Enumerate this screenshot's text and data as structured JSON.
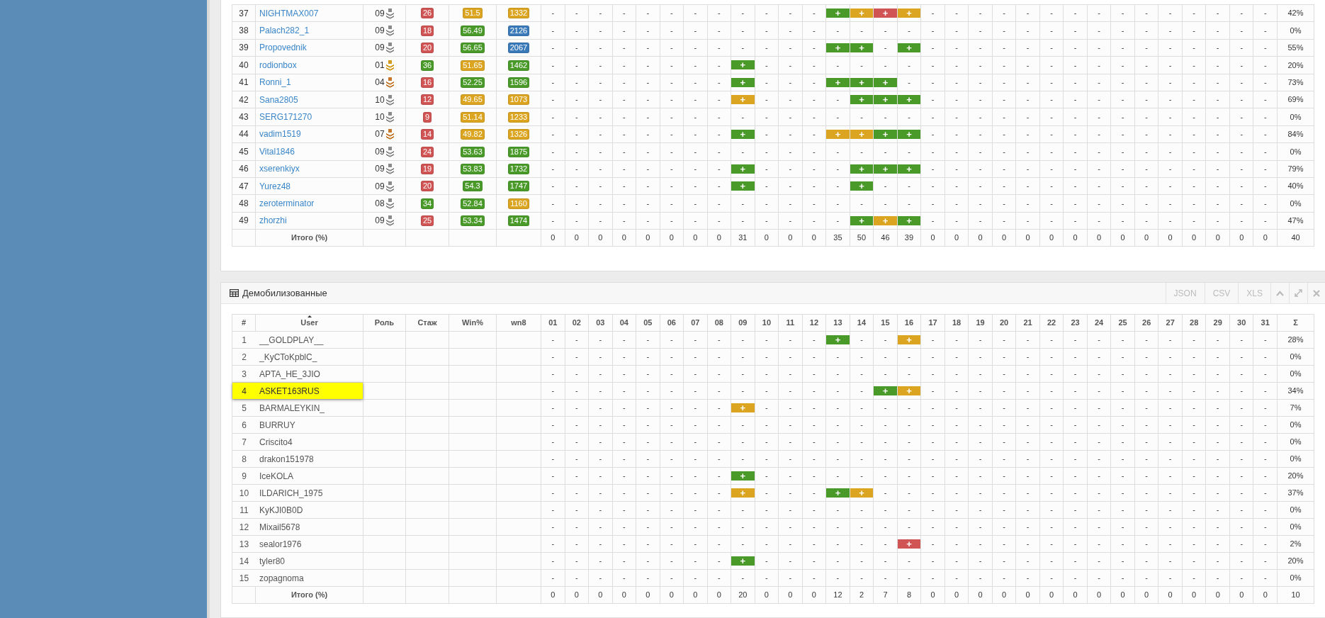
{
  "top_table": {
    "rows": [
      {
        "n": "37",
        "user": "NIGHTMAX007",
        "role": "09",
        "color": "#8a8a8a",
        "stazh": {
          "text": "26",
          "color": "#d05454"
        },
        "win": {
          "text": "51.5",
          "color": "#dba521"
        },
        "wn8": {
          "text": "1332",
          "color": "#dba521"
        },
        "days": [
          "-",
          "-",
          "-",
          "-",
          "-",
          "-",
          "-",
          "-",
          "-",
          "-",
          "-",
          "-",
          {
            "text": "+",
            "color": "#4a9a2a"
          },
          {
            "text": "+",
            "color": "#dba521"
          },
          {
            "text": "+",
            "color": "#d05454"
          },
          {
            "text": "+",
            "color": "#dba521"
          },
          "-",
          "-",
          "-",
          "-",
          "-",
          "-",
          "-",
          "-",
          "-",
          "-",
          "-",
          "-",
          "-",
          "-",
          "-"
        ],
        "sum": "42%"
      },
      {
        "n": "38",
        "user": "Palach282_1",
        "role": "09",
        "color": "#8a8a8a",
        "stazh": {
          "text": "18",
          "color": "#d05454"
        },
        "win": {
          "text": "56.49",
          "color": "#4a9a2a"
        },
        "wn8": {
          "text": "2126",
          "color": "#3a7ab8"
        },
        "days": [
          "-",
          "-",
          "-",
          "-",
          "-",
          "-",
          "-",
          "-",
          "-",
          "-",
          "-",
          "-",
          "-",
          "-",
          "-",
          "-",
          "-",
          "-",
          "-",
          "-",
          "-",
          "-",
          "-",
          "-",
          "-",
          "-",
          "-",
          "-",
          "-",
          "-",
          "-"
        ],
        "sum": "0%"
      },
      {
        "n": "39",
        "user": "Propovednik",
        "role": "09",
        "color": "#8a8a8a",
        "stazh": {
          "text": "20",
          "color": "#d05454"
        },
        "win": {
          "text": "56.65",
          "color": "#4a9a2a"
        },
        "wn8": {
          "text": "2067",
          "color": "#3a7ab8"
        },
        "days": [
          "-",
          "-",
          "-",
          "-",
          "-",
          "-",
          "-",
          "-",
          "-",
          "-",
          "-",
          "-",
          {
            "text": "+",
            "color": "#4a9a2a"
          },
          {
            "text": "+",
            "color": "#4a9a2a"
          },
          "-",
          {
            "text": "+",
            "color": "#4a9a2a"
          },
          "-",
          "-",
          "-",
          "-",
          "-",
          "-",
          "-",
          "-",
          "-",
          "-",
          "-",
          "-",
          "-",
          "-",
          "-"
        ],
        "sum": "55%"
      },
      {
        "n": "40",
        "user": "rodionbox",
        "role": "01",
        "color": "#d39a1c",
        "stazh": {
          "text": "36",
          "color": "#4a9a2a"
        },
        "win": {
          "text": "51.65",
          "color": "#dba521"
        },
        "wn8": {
          "text": "1462",
          "color": "#4a9a2a"
        },
        "days": [
          "-",
          "-",
          "-",
          "-",
          "-",
          "-",
          "-",
          "-",
          {
            "text": "+",
            "color": "#4a9a2a"
          },
          "-",
          "-",
          "-",
          "-",
          "-",
          "-",
          "-",
          "-",
          "-",
          "-",
          "-",
          "-",
          "-",
          "-",
          "-",
          "-",
          "-",
          "-",
          "-",
          "-",
          "-",
          "-"
        ],
        "sum": "20%"
      },
      {
        "n": "41",
        "user": "Ronni_1",
        "role": "04",
        "color": "#c8782c",
        "stazh": {
          "text": "16",
          "color": "#d05454"
        },
        "win": {
          "text": "52.25",
          "color": "#4a9a2a"
        },
        "wn8": {
          "text": "1596",
          "color": "#4a9a2a"
        },
        "days": [
          "-",
          "-",
          "-",
          "-",
          "-",
          "-",
          "-",
          "-",
          {
            "text": "+",
            "color": "#4a9a2a"
          },
          "-",
          "-",
          "-",
          {
            "text": "+",
            "color": "#4a9a2a"
          },
          {
            "text": "+",
            "color": "#4a9a2a"
          },
          {
            "text": "+",
            "color": "#4a9a2a"
          },
          "-",
          "-",
          "-",
          "-",
          "-",
          "-",
          "-",
          "-",
          "-",
          "-",
          "-",
          "-",
          "-",
          "-",
          "-",
          "-"
        ],
        "sum": "73%"
      },
      {
        "n": "42",
        "user": "Sana2805",
        "role": "10",
        "color": "#8a8a8a",
        "stazh": {
          "text": "12",
          "color": "#d05454"
        },
        "win": {
          "text": "49.65",
          "color": "#dba521"
        },
        "wn8": {
          "text": "1073",
          "color": "#dba521"
        },
        "days": [
          "-",
          "-",
          "-",
          "-",
          "-",
          "-",
          "-",
          "-",
          {
            "text": "+",
            "color": "#dba521"
          },
          "-",
          "-",
          "-",
          "-",
          {
            "text": "+",
            "color": "#4a9a2a"
          },
          {
            "text": "+",
            "color": "#4a9a2a"
          },
          {
            "text": "+",
            "color": "#4a9a2a"
          },
          "-",
          "-",
          "-",
          "-",
          "-",
          "-",
          "-",
          "-",
          "-",
          "-",
          "-",
          "-",
          "-",
          "-",
          "-"
        ],
        "sum": "69%"
      },
      {
        "n": "43",
        "user": "SERG171270",
        "role": "10",
        "color": "#8a8a8a",
        "stazh": {
          "text": "9",
          "color": "#d05454"
        },
        "win": {
          "text": "51.14",
          "color": "#dba521"
        },
        "wn8": {
          "text": "1233",
          "color": "#dba521"
        },
        "days": [
          "-",
          "-",
          "-",
          "-",
          "-",
          "-",
          "-",
          "-",
          "-",
          "-",
          "-",
          "-",
          "-",
          "-",
          "-",
          "-",
          "-",
          "-",
          "-",
          "-",
          "-",
          "-",
          "-",
          "-",
          "-",
          "-",
          "-",
          "-",
          "-",
          "-",
          "-"
        ],
        "sum": "0%"
      },
      {
        "n": "44",
        "user": "vadim1519",
        "role": "07",
        "color": "#c8782c",
        "stazh": {
          "text": "14",
          "color": "#d05454"
        },
        "win": {
          "text": "49.82",
          "color": "#dba521"
        },
        "wn8": {
          "text": "1326",
          "color": "#dba521"
        },
        "days": [
          "-",
          "-",
          "-",
          "-",
          "-",
          "-",
          "-",
          "-",
          {
            "text": "+",
            "color": "#4a9a2a"
          },
          "-",
          "-",
          "-",
          {
            "text": "+",
            "color": "#dba521"
          },
          {
            "text": "+",
            "color": "#dba521"
          },
          {
            "text": "+",
            "color": "#4a9a2a"
          },
          {
            "text": "+",
            "color": "#4a9a2a"
          },
          "-",
          "-",
          "-",
          "-",
          "-",
          "-",
          "-",
          "-",
          "-",
          "-",
          "-",
          "-",
          "-",
          "-",
          "-"
        ],
        "sum": "84%"
      },
      {
        "n": "45",
        "user": "Vital1846",
        "role": "09",
        "color": "#8a8a8a",
        "stazh": {
          "text": "24",
          "color": "#d05454"
        },
        "win": {
          "text": "53.63",
          "color": "#4a9a2a"
        },
        "wn8": {
          "text": "1875",
          "color": "#4a9a2a"
        },
        "days": [
          "-",
          "-",
          "-",
          "-",
          "-",
          "-",
          "-",
          "-",
          "-",
          "-",
          "-",
          "-",
          "-",
          "-",
          "-",
          "-",
          "-",
          "-",
          "-",
          "-",
          "-",
          "-",
          "-",
          "-",
          "-",
          "-",
          "-",
          "-",
          "-",
          "-",
          "-"
        ],
        "sum": "0%"
      },
      {
        "n": "46",
        "user": "xserenkiyx",
        "role": "09",
        "color": "#8a8a8a",
        "stazh": {
          "text": "19",
          "color": "#d05454"
        },
        "win": {
          "text": "53.83",
          "color": "#4a9a2a"
        },
        "wn8": {
          "text": "1732",
          "color": "#4a9a2a"
        },
        "days": [
          "-",
          "-",
          "-",
          "-",
          "-",
          "-",
          "-",
          "-",
          {
            "text": "+",
            "color": "#4a9a2a"
          },
          "-",
          "-",
          "-",
          "-",
          {
            "text": "+",
            "color": "#4a9a2a"
          },
          {
            "text": "+",
            "color": "#4a9a2a"
          },
          {
            "text": "+",
            "color": "#4a9a2a"
          },
          "-",
          "-",
          "-",
          "-",
          "-",
          "-",
          "-",
          "-",
          "-",
          "-",
          "-",
          "-",
          "-",
          "-",
          "-"
        ],
        "sum": "79%"
      },
      {
        "n": "47",
        "user": "Yurez48",
        "role": "09",
        "color": "#8a8a8a",
        "stazh": {
          "text": "20",
          "color": "#d05454"
        },
        "win": {
          "text": "54.3",
          "color": "#4a9a2a"
        },
        "wn8": {
          "text": "1747",
          "color": "#4a9a2a"
        },
        "days": [
          "-",
          "-",
          "-",
          "-",
          "-",
          "-",
          "-",
          "-",
          {
            "text": "+",
            "color": "#4a9a2a"
          },
          "-",
          "-",
          "-",
          "-",
          {
            "text": "+",
            "color": "#4a9a2a"
          },
          "-",
          "-",
          "-",
          "-",
          "-",
          "-",
          "-",
          "-",
          "-",
          "-",
          "-",
          "-",
          "-",
          "-",
          "-",
          "-",
          "-"
        ],
        "sum": "40%"
      },
      {
        "n": "48",
        "user": "zeroterminator",
        "role": "08",
        "color": "#8a8a8a",
        "stazh": {
          "text": "34",
          "color": "#4a9a2a"
        },
        "win": {
          "text": "52.84",
          "color": "#4a9a2a"
        },
        "wn8": {
          "text": "1160",
          "color": "#dba521"
        },
        "days": [
          "-",
          "-",
          "-",
          "-",
          "-",
          "-",
          "-",
          "-",
          "-",
          "-",
          "-",
          "-",
          "-",
          "-",
          "-",
          "-",
          "-",
          "-",
          "-",
          "-",
          "-",
          "-",
          "-",
          "-",
          "-",
          "-",
          "-",
          "-",
          "-",
          "-",
          "-"
        ],
        "sum": "0%"
      },
      {
        "n": "49",
        "user": "zhorzhi",
        "role": "09",
        "color": "#8a8a8a",
        "stazh": {
          "text": "25",
          "color": "#d05454"
        },
        "win": {
          "text": "53.34",
          "color": "#4a9a2a"
        },
        "wn8": {
          "text": "1474",
          "color": "#4a9a2a"
        },
        "days": [
          "-",
          "-",
          "-",
          "-",
          "-",
          "-",
          "-",
          "-",
          "-",
          "-",
          "-",
          "-",
          "-",
          {
            "text": "+",
            "color": "#4a9a2a"
          },
          {
            "text": "+",
            "color": "#dba521"
          },
          {
            "text": "+",
            "color": "#4a9a2a"
          },
          "-",
          "-",
          "-",
          "-",
          "-",
          "-",
          "-",
          "-",
          "-",
          "-",
          "-",
          "-",
          "-",
          "-",
          "-"
        ],
        "sum": "47%"
      }
    ],
    "footer": {
      "label": "Итого (%)",
      "days": [
        "0",
        "0",
        "0",
        "0",
        "0",
        "0",
        "0",
        "0",
        "31",
        "0",
        "0",
        "0",
        "35",
        "50",
        "46",
        "39",
        "0",
        "0",
        "0",
        "0",
        "0",
        "0",
        "0",
        "0",
        "0",
        "0",
        "0",
        "0",
        "0",
        "0",
        "0"
      ],
      "sum": "40"
    }
  },
  "panel": {
    "title": "Демобилизованные",
    "actions": [
      "JSON",
      "CSV",
      "XLS"
    ]
  },
  "bottom_table": {
    "columns": [
      "#",
      "User",
      "Роль",
      "Стаж",
      "Win%",
      "wn8",
      "01",
      "02",
      "03",
      "04",
      "05",
      "06",
      "07",
      "08",
      "09",
      "10",
      "11",
      "12",
      "13",
      "14",
      "15",
      "16",
      "17",
      "18",
      "19",
      "20",
      "21",
      "22",
      "23",
      "24",
      "25",
      "26",
      "27",
      "28",
      "29",
      "30",
      "31",
      "Σ"
    ],
    "rows": [
      {
        "n": "1",
        "user": "__GOLDPLAY__",
        "selected": false,
        "days": [
          "-",
          "-",
          "-",
          "-",
          "-",
          "-",
          "-",
          "-",
          "-",
          "-",
          "-",
          "-",
          {
            "text": "+",
            "color": "#4a9a2a"
          },
          "-",
          "-",
          {
            "text": "+",
            "color": "#dba521"
          },
          "-",
          "-",
          "-",
          "-",
          "-",
          "-",
          "-",
          "-",
          "-",
          "-",
          "-",
          "-",
          "-",
          "-",
          "-"
        ],
        "sum": "28%"
      },
      {
        "n": "2",
        "user": "_KyCToKpblC_",
        "selected": false,
        "days": [
          "-",
          "-",
          "-",
          "-",
          "-",
          "-",
          "-",
          "-",
          "-",
          "-",
          "-",
          "-",
          "-",
          "-",
          "-",
          "-",
          "-",
          "-",
          "-",
          "-",
          "-",
          "-",
          "-",
          "-",
          "-",
          "-",
          "-",
          "-",
          "-",
          "-",
          "-"
        ],
        "sum": "0%"
      },
      {
        "n": "3",
        "user": "APTA_HE_3JIO",
        "selected": false,
        "days": [
          "-",
          "-",
          "-",
          "-",
          "-",
          "-",
          "-",
          "-",
          "-",
          "-",
          "-",
          "-",
          "-",
          "-",
          "-",
          "-",
          "-",
          "-",
          "-",
          "-",
          "-",
          "-",
          "-",
          "-",
          "-",
          "-",
          "-",
          "-",
          "-",
          "-",
          "-"
        ],
        "sum": "0%"
      },
      {
        "n": "4",
        "user": "ASKET163RUS",
        "selected": true,
        "days": [
          "-",
          "-",
          "-",
          "-",
          "-",
          "-",
          "-",
          "-",
          "-",
          "-",
          "-",
          "-",
          "-",
          "-",
          {
            "text": "+",
            "color": "#4a9a2a"
          },
          {
            "text": "+",
            "color": "#dba521"
          },
          "-",
          "-",
          "-",
          "-",
          "-",
          "-",
          "-",
          "-",
          "-",
          "-",
          "-",
          "-",
          "-",
          "-",
          "-"
        ],
        "sum": "34%"
      },
      {
        "n": "5",
        "user": "BARMALEYKIN_",
        "selected": false,
        "days": [
          "-",
          "-",
          "-",
          "-",
          "-",
          "-",
          "-",
          "-",
          {
            "text": "+",
            "color": "#dba521"
          },
          "-",
          "-",
          "-",
          "-",
          "-",
          "-",
          "-",
          "-",
          "-",
          "-",
          "-",
          "-",
          "-",
          "-",
          "-",
          "-",
          "-",
          "-",
          "-",
          "-",
          "-",
          "-"
        ],
        "sum": "7%"
      },
      {
        "n": "6",
        "user": "BURRUY",
        "selected": false,
        "days": [
          "-",
          "-",
          "-",
          "-",
          "-",
          "-",
          "-",
          "-",
          "-",
          "-",
          "-",
          "-",
          "-",
          "-",
          "-",
          "-",
          "-",
          "-",
          "-",
          "-",
          "-",
          "-",
          "-",
          "-",
          "-",
          "-",
          "-",
          "-",
          "-",
          "-",
          "-"
        ],
        "sum": "0%"
      },
      {
        "n": "7",
        "user": "Criscito4",
        "selected": false,
        "days": [
          "-",
          "-",
          "-",
          "-",
          "-",
          "-",
          "-",
          "-",
          "-",
          "-",
          "-",
          "-",
          "-",
          "-",
          "-",
          "-",
          "-",
          "-",
          "-",
          "-",
          "-",
          "-",
          "-",
          "-",
          "-",
          "-",
          "-",
          "-",
          "-",
          "-",
          "-"
        ],
        "sum": "0%"
      },
      {
        "n": "8",
        "user": "drakon151978",
        "selected": false,
        "days": [
          "-",
          "-",
          "-",
          "-",
          "-",
          "-",
          "-",
          "-",
          "-",
          "-",
          "-",
          "-",
          "-",
          "-",
          "-",
          "-",
          "-",
          "-",
          "-",
          "-",
          "-",
          "-",
          "-",
          "-",
          "-",
          "-",
          "-",
          "-",
          "-",
          "-",
          "-"
        ],
        "sum": "0%"
      },
      {
        "n": "9",
        "user": "IceKOLA",
        "selected": false,
        "days": [
          "-",
          "-",
          "-",
          "-",
          "-",
          "-",
          "-",
          "-",
          {
            "text": "+",
            "color": "#4a9a2a"
          },
          "-",
          "-",
          "-",
          "-",
          "-",
          "-",
          "-",
          "-",
          "-",
          "-",
          "-",
          "-",
          "-",
          "-",
          "-",
          "-",
          "-",
          "-",
          "-",
          "-",
          "-",
          "-"
        ],
        "sum": "20%"
      },
      {
        "n": "10",
        "user": "ILDARICH_1975",
        "selected": false,
        "days": [
          "-",
          "-",
          "-",
          "-",
          "-",
          "-",
          "-",
          "-",
          {
            "text": "+",
            "color": "#dba521"
          },
          "-",
          "-",
          "-",
          {
            "text": "+",
            "color": "#4a9a2a"
          },
          {
            "text": "+",
            "color": "#dba521"
          },
          "-",
          "-",
          "-",
          "-",
          "-",
          "-",
          "-",
          "-",
          "-",
          "-",
          "-",
          "-",
          "-",
          "-",
          "-",
          "-",
          "-"
        ],
        "sum": "37%"
      },
      {
        "n": "11",
        "user": "KyKJI0B0D",
        "selected": false,
        "days": [
          "-",
          "-",
          "-",
          "-",
          "-",
          "-",
          "-",
          "-",
          "-",
          "-",
          "-",
          "-",
          "-",
          "-",
          "-",
          "-",
          "-",
          "-",
          "-",
          "-",
          "-",
          "-",
          "-",
          "-",
          "-",
          "-",
          "-",
          "-",
          "-",
          "-",
          "-"
        ],
        "sum": "0%"
      },
      {
        "n": "12",
        "user": "Mixail5678",
        "selected": false,
        "days": [
          "-",
          "-",
          "-",
          "-",
          "-",
          "-",
          "-",
          "-",
          "-",
          "-",
          "-",
          "-",
          "-",
          "-",
          "-",
          "-",
          "-",
          "-",
          "-",
          "-",
          "-",
          "-",
          "-",
          "-",
          "-",
          "-",
          "-",
          "-",
          "-",
          "-",
          "-"
        ],
        "sum": "0%"
      },
      {
        "n": "13",
        "user": "sealor1976",
        "selected": false,
        "days": [
          "-",
          "-",
          "-",
          "-",
          "-",
          "-",
          "-",
          "-",
          "-",
          "-",
          "-",
          "-",
          "-",
          "-",
          "-",
          {
            "text": "+",
            "color": "#d05454"
          },
          "-",
          "-",
          "-",
          "-",
          "-",
          "-",
          "-",
          "-",
          "-",
          "-",
          "-",
          "-",
          "-",
          "-",
          "-"
        ],
        "sum": "2%"
      },
      {
        "n": "14",
        "user": "tyler80",
        "selected": false,
        "days": [
          "-",
          "-",
          "-",
          "-",
          "-",
          "-",
          "-",
          "-",
          {
            "text": "+",
            "color": "#4a9a2a"
          },
          "-",
          "-",
          "-",
          "-",
          "-",
          "-",
          "-",
          "-",
          "-",
          "-",
          "-",
          "-",
          "-",
          "-",
          "-",
          "-",
          "-",
          "-",
          "-",
          "-",
          "-",
          "-"
        ],
        "sum": "20%"
      },
      {
        "n": "15",
        "user": "zopagnoma",
        "selected": false,
        "days": [
          "-",
          "-",
          "-",
          "-",
          "-",
          "-",
          "-",
          "-",
          "-",
          "-",
          "-",
          "-",
          "-",
          "-",
          "-",
          "-",
          "-",
          "-",
          "-",
          "-",
          "-",
          "-",
          "-",
          "-",
          "-",
          "-",
          "-",
          "-",
          "-",
          "-",
          "-"
        ],
        "sum": "0%"
      }
    ],
    "footer": {
      "label": "Итого (%)",
      "days": [
        "0",
        "0",
        "0",
        "0",
        "0",
        "0",
        "0",
        "0",
        "20",
        "0",
        "0",
        "0",
        "12",
        "2",
        "7",
        "8",
        "0",
        "0",
        "0",
        "0",
        "0",
        "0",
        "0",
        "0",
        "0",
        "0",
        "0",
        "0",
        "0",
        "0",
        "0"
      ],
      "sum": "10"
    }
  }
}
